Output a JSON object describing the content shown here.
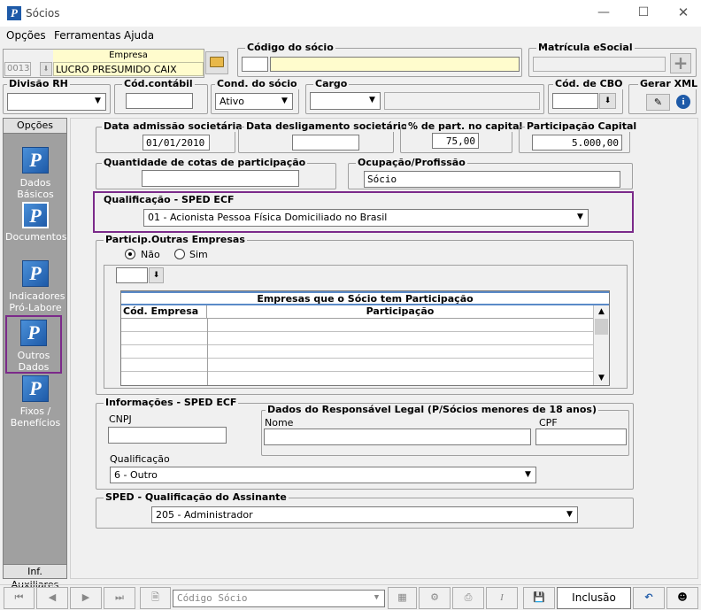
{
  "window": {
    "title": "Sócios"
  },
  "menu": [
    "Opções",
    "Ferramentas",
    "Ajuda"
  ],
  "empresa": {
    "label": "Empresa",
    "code": "0013",
    "name": "LUCRO PRESUMIDO CAIX"
  },
  "codigo_socio": {
    "label": "Código do sócio",
    "code": "",
    "name": ""
  },
  "matricula": {
    "label": "Matrícula eSocial",
    "value": ""
  },
  "divisao": {
    "label": "Divisão RH",
    "value": ""
  },
  "cod_contabil": {
    "label": "Cód.contábil",
    "value": ""
  },
  "cond_socio": {
    "label": "Cond. do sócio",
    "value": "Ativo"
  },
  "cargo": {
    "label": "Cargo",
    "value": ""
  },
  "cbo": {
    "label": "Cód. de CBO",
    "value": ""
  },
  "gerar_xml": {
    "label": "Gerar XML"
  },
  "sidebar": {
    "title": "Opções",
    "items": [
      "Dados Básicos",
      "Documentos",
      "Indicadores Pró-Labore",
      "Outros Dados",
      "Fixos / Benefícios"
    ],
    "footer": "Inf. Auxiliares"
  },
  "main": {
    "data_admissao": {
      "label": "Data admissão societária",
      "value": "01/01/2010"
    },
    "data_desligamento": {
      "label": "Data desligamento societário",
      "value": ""
    },
    "perc_capital": {
      "label": "% de part. no capital",
      "value": "75,00"
    },
    "part_capital": {
      "label": "Participação Capital",
      "value": "5.000,00"
    },
    "qtd_cotas": {
      "label": "Quantidade de cotas de participação",
      "value": ""
    },
    "ocupacao": {
      "label": "Ocupação/Profissão",
      "value": "Sócio"
    },
    "qualificacao_sped": {
      "label": "Qualificação - SPED ECF",
      "value": "01 - Acionista Pessoa Física Domiciliado no Brasil"
    },
    "particip": {
      "label": "Particip.Outras Empresas",
      "opt_nao": "Não",
      "opt_sim": "Sim",
      "selected": "Não"
    },
    "grid": {
      "title": "Empresas que o Sócio tem Participação",
      "col1": "Cód. Empresa",
      "col2": "Participação"
    },
    "info_sped": {
      "label": "Informações - SPED ECF",
      "cnpj_label": "CNPJ",
      "cnpj": "",
      "qualif_label": "Qualificação",
      "qualif": "6 - Outro"
    },
    "responsavel": {
      "label": "Dados do Responsável Legal (P/Sócios menores de 18 anos)",
      "nome_label": "Nome",
      "nome": "",
      "cpf_label": "CPF",
      "cpf": ""
    },
    "assinante": {
      "label": "SPED - Qualificação do Assinante",
      "value": "205 - Administrador"
    }
  },
  "toolbar": {
    "search_placeholder": "Código Sócio",
    "mode": "Inclusão"
  }
}
